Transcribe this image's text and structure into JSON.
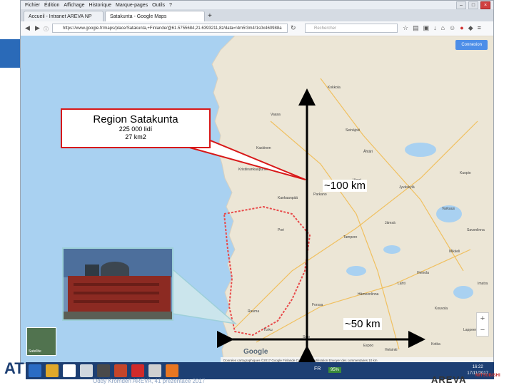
{
  "browser": {
    "menu": [
      "Fichier",
      "Édition",
      "Affichage",
      "Historique",
      "Marque-pages",
      "Outils",
      "?"
    ],
    "tabs": [
      {
        "label": "Accueil - Intranet AREVA NP",
        "active": false
      },
      {
        "label": "Satakunta - Google Maps",
        "active": true
      }
    ],
    "url": "https://www.google.fr/maps/place/Satakunta,+Finlande/@61.5755684,21.6393211,8z/data=!4m5!3m4!1s0x460988a",
    "search_placeholder": "Rechercher",
    "connexion_label": "Connexion"
  },
  "map": {
    "satellite_label": "Satellite",
    "google_logo": "Google",
    "footer_text": "Données cartographiques ©2017 Google   Finlande   Conditions d'utilisation   Envoyer des commentaires   10 km",
    "place_labels": [
      "Vaasa",
      "Seinäjoki",
      "Kokkola",
      "Kaskinen",
      "Kristiinankaupunki",
      "Pori",
      "Rauma",
      "Tampere",
      "Jyväskylä",
      "Turku",
      "Lahti",
      "Hämeenlinna",
      "Kouvola",
      "Mikkeli",
      "Kuopio",
      "Varkaus",
      "Savonlinna",
      "Lappeenranta",
      "Kotka",
      "Helsinki",
      "Espoo",
      "Salo",
      "Forssa",
      "Ähtäri",
      "Virrat",
      "Kankaanpää",
      "Parkano",
      "Jämsä",
      "Heinola",
      "Imatra"
    ],
    "zoom_in": "+",
    "zoom_out": "−"
  },
  "annotations": {
    "callout_title": "Region Satakunta",
    "callout_line1": "225 000 lidí",
    "callout_line2": "27 km2",
    "distance_vertical": "~100 km",
    "distance_horizontal": "~50 km"
  },
  "taskbar": {
    "lang": "FR",
    "battery": "95%",
    "time": "16:22",
    "date": "17/11/2017"
  },
  "slide": {
    "footer_text": "Oddy Kromdeň AREVA, 41 prezentace 2017",
    "corner_logo": "AT",
    "areva_logo": "AREVA",
    "partner_logo": "MITSUBISHI"
  },
  "colors": {
    "map_sea": "#a9d1f1",
    "map_land": "#ece6d6",
    "region_border": "#e84a4a",
    "annotation_red": "#d81818",
    "taskbar": "#1d3f73"
  }
}
